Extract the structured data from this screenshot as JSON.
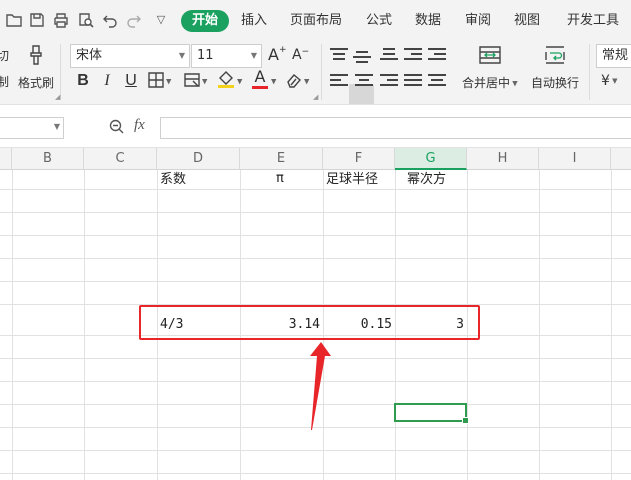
{
  "menu": {
    "tabs": [
      {
        "label": "开始",
        "active": true
      },
      {
        "label": "插入"
      },
      {
        "label": "页面布局"
      },
      {
        "label": "公式"
      },
      {
        "label": "数据"
      },
      {
        "label": "审阅"
      },
      {
        "label": "视图"
      },
      {
        "label": "开发工具"
      }
    ],
    "accent_color": "#1aa15f"
  },
  "ribbon": {
    "cut_partial": "切",
    "copy_partial": "制",
    "format_painter_label": "格式刷",
    "font_name": "宋体",
    "font_size": "11",
    "bold": "B",
    "italic": "I",
    "underline": "U",
    "font_color_glyph": "A",
    "font_color": "#e8262a",
    "fill_color": "#f2d21b",
    "merge_center_label": "合并居中",
    "wrap_text_label": "自动换行",
    "number_format": "常规",
    "currency_symbol": "¥"
  },
  "formula_bar": {
    "fx_label": "fx",
    "value": ""
  },
  "columns": [
    "B",
    "C",
    "D",
    "E",
    "F",
    "G",
    "H",
    "I"
  ],
  "selected_column": "G",
  "headers_row": {
    "D": "系数",
    "E": "π",
    "F": "足球半径",
    "G": "幂次方"
  },
  "values_row": {
    "D": "4/3",
    "E": "3.14",
    "F": "0.15",
    "G": "3"
  },
  "annotation": {
    "highlight_color": "#e8262a"
  }
}
